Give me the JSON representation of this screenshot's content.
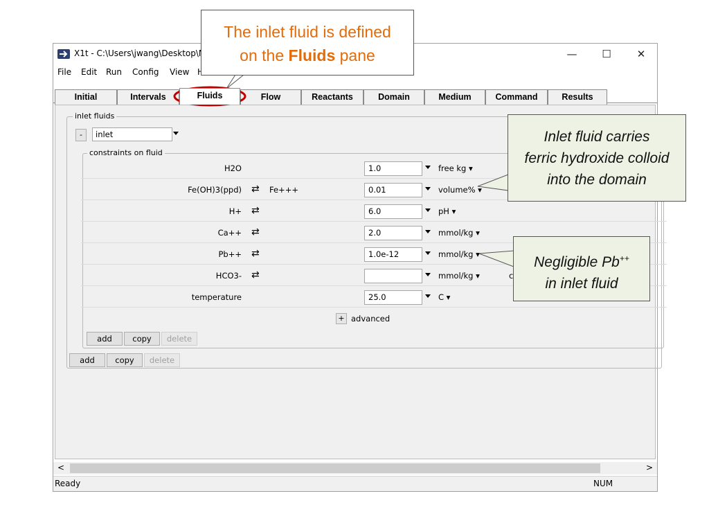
{
  "window": {
    "title": "X1t - C:\\Users\\jwang\\Desktop\\M",
    "controls": {
      "minimize": "—",
      "maximize": "☐",
      "close": "✕"
    }
  },
  "menu": [
    "File",
    "Edit",
    "Run",
    "Config",
    "View",
    "H"
  ],
  "tabs": [
    "Initial",
    "Intervals",
    "Fluids",
    "Flow",
    "Reactants",
    "Domain",
    "Medium",
    "Command",
    "Results"
  ],
  "active_tab": "Fluids",
  "inlet_fluids": {
    "group_label": "inlet fluids",
    "collapse": "-",
    "selected_fluid": "inlet",
    "constraints_label": "constraints on fluid",
    "rows": [
      {
        "species": "H2O",
        "swap": "",
        "basis": "",
        "value": "1.0",
        "unit": "free kg"
      },
      {
        "species": "Fe(OH)3(ppd)",
        "swap": "⇄",
        "basis": "Fe+++",
        "value": "0.01",
        "unit": "volume%"
      },
      {
        "species": "H+",
        "swap": "⇄",
        "basis": "",
        "value": "6.0",
        "unit": "pH"
      },
      {
        "species": "Ca++",
        "swap": "⇄",
        "basis": "",
        "value": "2.0",
        "unit": "mmol/kg"
      },
      {
        "species": "Pb++",
        "swap": "⇄",
        "basis": "",
        "value": "1.0e-12",
        "unit": "mmol/kg"
      },
      {
        "species": "HCO3-",
        "swap": "⇄",
        "basis": "",
        "value": "",
        "unit": "mmol/kg",
        "extra": "c"
      },
      {
        "species": "temperature",
        "swap": "",
        "basis": "",
        "value": "25.0",
        "unit": "C"
      }
    ],
    "advanced_toggle": "+",
    "advanced_label": "advanced",
    "inner_buttons": {
      "add": "add",
      "copy": "copy",
      "delete": "delete"
    },
    "outer_buttons": {
      "add": "add",
      "copy": "copy",
      "delete": "delete"
    }
  },
  "scrollbar": {
    "left": "<",
    "right": ">"
  },
  "status": {
    "text": "Ready",
    "num": "NUM"
  },
  "callouts": {
    "top_line1": "The inlet fluid is defined",
    "top_line2_pre": "on the ",
    "top_line2_bold": "Fluids",
    "top_line2_post": " pane",
    "right1_line1": "Inlet fluid carries",
    "right1_line2": "ferric hydroxide colloid",
    "right1_line3": "into the domain",
    "right2_line1": "Negligible Pb",
    "right2_sup": "++",
    "right2_line2": "in inlet fluid"
  },
  "colors": {
    "callout_text": "#e36c0a",
    "callout_fill": "#eef2e4",
    "tab_highlight": "#c00000"
  }
}
